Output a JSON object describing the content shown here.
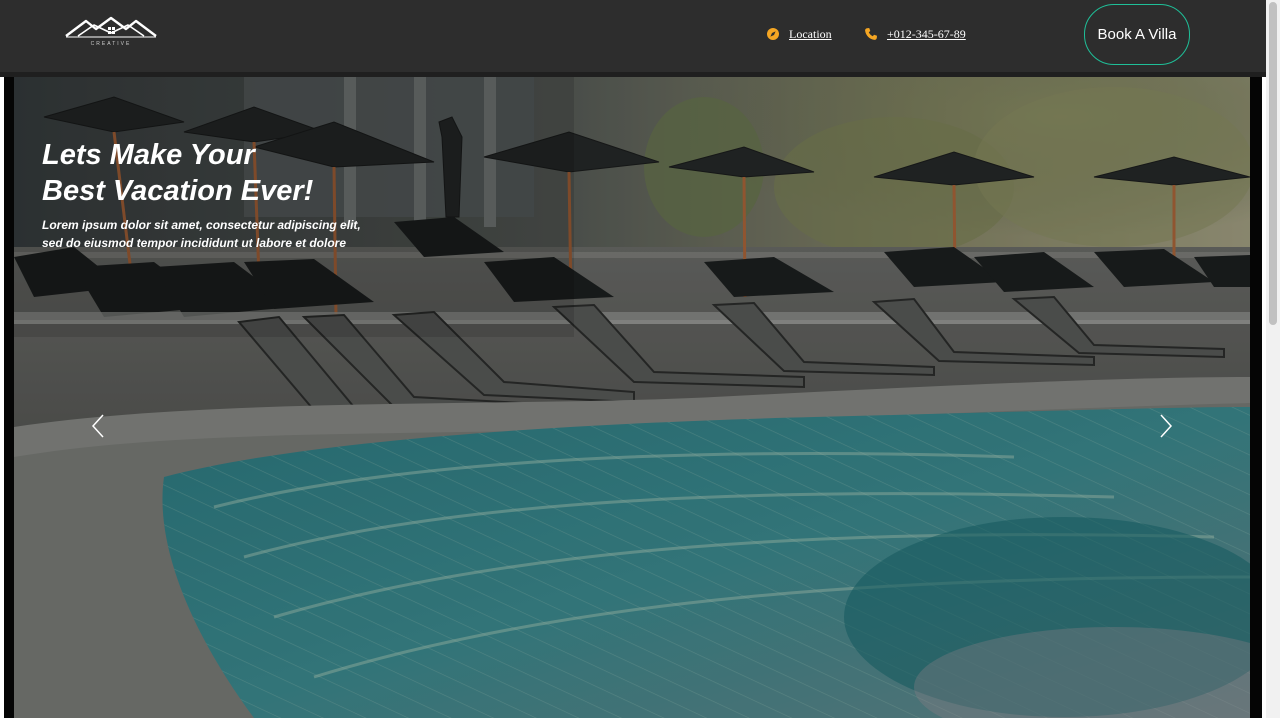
{
  "header": {
    "logo": {
      "name": "creative-logo",
      "text": "CREATIVE"
    },
    "nav": {
      "location": {
        "label": "Location",
        "icon": "compass-icon"
      },
      "phone": {
        "label": "+012-345-67-89",
        "icon": "phone-icon"
      }
    },
    "cta": {
      "label": "Book A Villa"
    }
  },
  "hero": {
    "title_line1": "Lets Make Your",
    "title_line2": "Best Vacation Ever!",
    "subtitle_line1": "Lorem ipsum dolor sit amet, consectetur adipiscing elit,",
    "subtitle_line2": "sed do eiusmod tempor incididunt ut labore et dolore",
    "prev_icon": "chevron-left-icon",
    "next_icon": "chevron-right-icon"
  },
  "colors": {
    "header_bg": "#2d2d2d",
    "accent_orange": "#f5a623",
    "button_border": "#1fbf98",
    "text": "#ffffff"
  }
}
